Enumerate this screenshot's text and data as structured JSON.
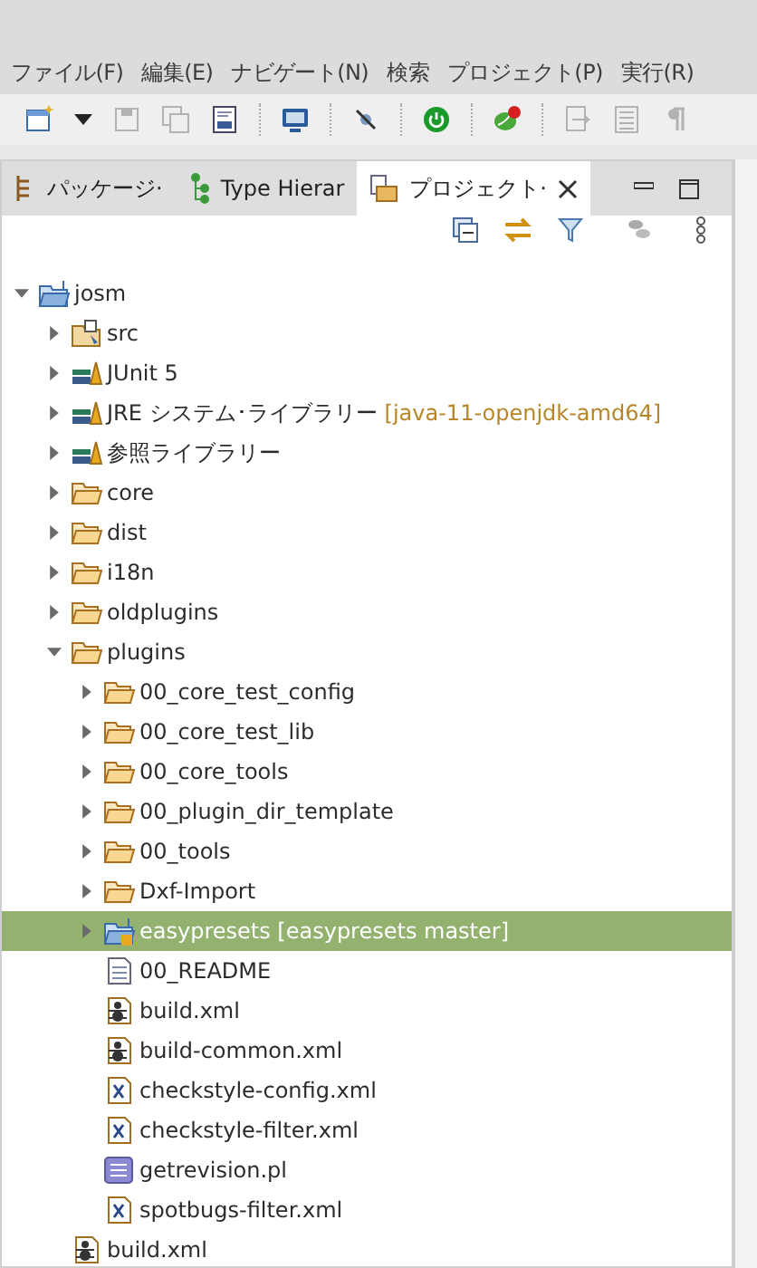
{
  "menu_bar": [
    {
      "label": "ファイル(F)"
    },
    {
      "label": "編集(E)"
    },
    {
      "label": "ナビゲート(N)"
    },
    {
      "label": "検索"
    },
    {
      "label": "プロジェクト(P)"
    },
    {
      "label": "実行(R)"
    }
  ],
  "toolbar": [
    {
      "kind": "new",
      "disabled": false
    },
    {
      "kind": "dropdown",
      "disabled": false
    },
    {
      "kind": "save",
      "disabled": true
    },
    {
      "kind": "save-all",
      "disabled": true
    },
    {
      "kind": "binary",
      "disabled": false
    },
    {
      "kind": "separator"
    },
    {
      "kind": "monitor",
      "disabled": false
    },
    {
      "kind": "separator"
    },
    {
      "kind": "pin",
      "disabled": false
    },
    {
      "kind": "separator"
    },
    {
      "kind": "power",
      "disabled": false
    },
    {
      "kind": "separator"
    },
    {
      "kind": "bean",
      "disabled": false
    },
    {
      "kind": "separator"
    },
    {
      "kind": "doc",
      "disabled": true
    },
    {
      "kind": "list",
      "disabled": true
    },
    {
      "kind": "pilcrow",
      "disabled": true
    }
  ],
  "tabs": [
    {
      "label": "パッケージ·",
      "kind": "package",
      "selected": false
    },
    {
      "label": "Type Hierar",
      "kind": "hierarchy",
      "selected": false
    },
    {
      "label": "プロジェクト·",
      "kind": "project",
      "selected": true
    }
  ],
  "tree": [
    {
      "label": "josm",
      "kind": "project",
      "expanded": true,
      "selected": false,
      "children": [
        {
          "label": "src",
          "kind": "source-folder",
          "expanded": false,
          "selected": false
        },
        {
          "label": "JUnit 5",
          "kind": "library",
          "expanded": false,
          "selected": false
        },
        {
          "label": "JRE システム･ライブラリー",
          "decoration": "[java-11-openjdk-amd64]",
          "kind": "library",
          "expanded": false,
          "selected": false
        },
        {
          "label": "参照ライブラリー",
          "kind": "library",
          "expanded": false,
          "selected": false
        },
        {
          "label": "core",
          "kind": "folder",
          "expanded": false,
          "selected": false
        },
        {
          "label": "dist",
          "kind": "folder",
          "expanded": false,
          "selected": false
        },
        {
          "label": "i18n",
          "kind": "folder",
          "expanded": false,
          "selected": false
        },
        {
          "label": "oldplugins",
          "kind": "folder",
          "expanded": false,
          "selected": false
        },
        {
          "label": "plugins",
          "kind": "folder",
          "expanded": true,
          "selected": false,
          "children": [
            {
              "label": "00_core_test_config",
              "kind": "folder",
              "expanded": false,
              "selected": false
            },
            {
              "label": "00_core_test_lib",
              "kind": "folder",
              "expanded": false,
              "selected": false
            },
            {
              "label": "00_core_tools",
              "kind": "folder",
              "expanded": false,
              "selected": false
            },
            {
              "label": "00_plugin_dir_template",
              "kind": "folder",
              "expanded": false,
              "selected": false
            },
            {
              "label": "00_tools",
              "kind": "folder",
              "expanded": false,
              "selected": false
            },
            {
              "label": "Dxf-Import",
              "kind": "folder",
              "expanded": false,
              "selected": false
            },
            {
              "label": "easypresets [easypresets master]",
              "kind": "git-project",
              "expanded": false,
              "selected": true
            },
            {
              "label": "00_README",
              "kind": "text-file",
              "selected": false
            },
            {
              "label": "build.xml",
              "kind": "ant-file",
              "selected": false
            },
            {
              "label": "build-common.xml",
              "kind": "ant-file",
              "selected": false
            },
            {
              "label": "checkstyle-config.xml",
              "kind": "xml-file",
              "selected": false
            },
            {
              "label": "checkstyle-filter.xml",
              "kind": "xml-file",
              "selected": false
            },
            {
              "label": "getrevision.pl",
              "kind": "script-file",
              "selected": false
            },
            {
              "label": "spotbugs-filter.xml",
              "kind": "xml-file",
              "selected": false
            }
          ]
        },
        {
          "label": "build.xml",
          "kind": "ant-file",
          "selected": false
        }
      ]
    }
  ]
}
